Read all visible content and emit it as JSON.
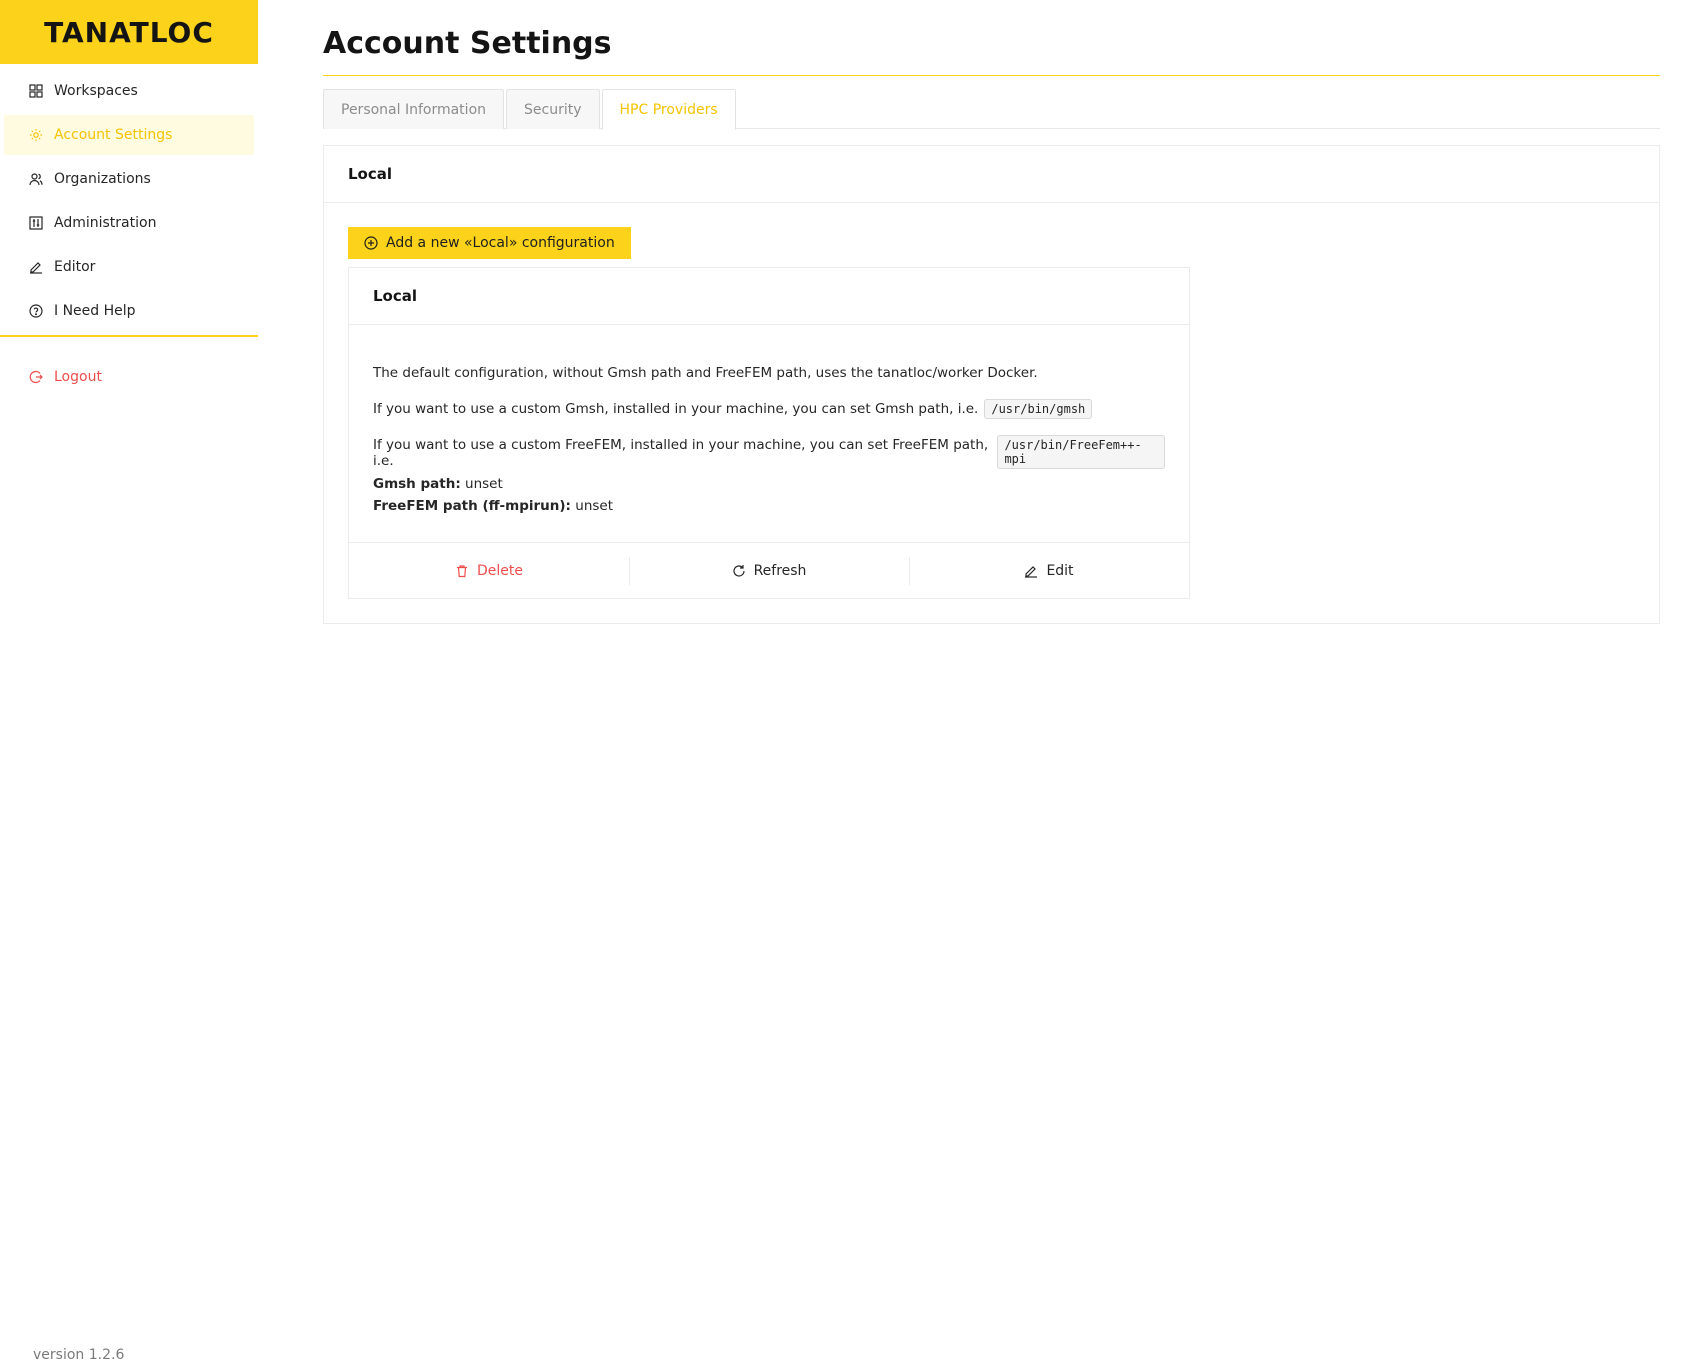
{
  "app": {
    "logo": "TANATLOC",
    "version": "version 1.2.6"
  },
  "sidebar": {
    "items": [
      {
        "label": "Workspaces",
        "icon": "grid-icon"
      },
      {
        "label": "Account Settings",
        "icon": "gear-icon",
        "active": true
      },
      {
        "label": "Organizations",
        "icon": "users-icon"
      },
      {
        "label": "Administration",
        "icon": "control-panel-icon"
      },
      {
        "label": "Editor",
        "icon": "pencil-icon"
      },
      {
        "label": "I Need Help",
        "icon": "question-icon"
      }
    ],
    "logout": {
      "label": "Logout",
      "icon": "logout-icon"
    }
  },
  "page": {
    "title": "Account Settings"
  },
  "tabs": [
    {
      "label": "Personal Information"
    },
    {
      "label": "Security"
    },
    {
      "label": "HPC Providers",
      "active": true
    }
  ],
  "panel": {
    "title": "Local",
    "add_button": "Add a new «Local» configuration",
    "card": {
      "title": "Local",
      "line1": "The default configuration, without Gmsh path and FreeFEM path, uses the tanatloc/worker Docker.",
      "line2": "If you want to use a custom Gmsh, installed in your machine, you can set Gmsh path, i.e.",
      "line2_code": "/usr/bin/gmsh",
      "line3": "If you want to use a custom FreeFEM, installed in your machine, you can set FreeFEM path, i.e.",
      "line3_code": "/usr/bin/FreeFem++-mpi",
      "gmsh_label": "Gmsh path:",
      "gmsh_value": "unset",
      "freefem_label": "FreeFEM path (ff-mpirun):",
      "freefem_value": "unset",
      "actions": {
        "delete": "Delete",
        "refresh": "Refresh",
        "edit": "Edit"
      }
    }
  },
  "colors": {
    "accent": "#fcd21b",
    "active_text": "#f5c400",
    "danger": "#ef4d4d"
  }
}
